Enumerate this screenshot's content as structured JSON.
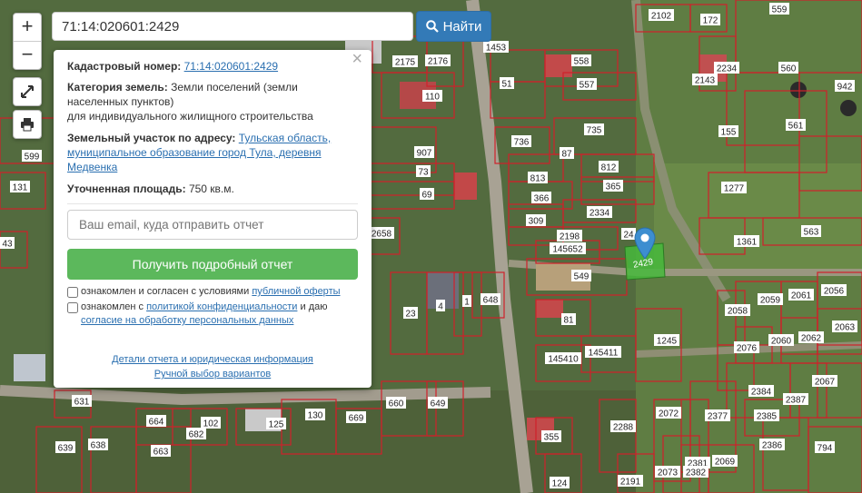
{
  "search": {
    "value": "71:14:020601:2429",
    "button_label": "Найти"
  },
  "zoom": {
    "in": "+",
    "out": "−"
  },
  "popup": {
    "cadastral_label": "Кадастровый номер:",
    "cadastral_value": "71:14:020601:2429",
    "category_label": "Категория земель:",
    "category_value": "Земли поселений (земли населенных пунктов)",
    "usage": "для индивидуального жилищного строительства",
    "address_label": "Земельный участок по адресу:",
    "address_value": "Тульская область, муниципальное образование город Тула, деревня Медвенка",
    "area_label": "Уточненная площадь:",
    "area_value": "750 кв.м.",
    "email_placeholder": "Ваш email, куда отправить отчет",
    "report_button": "Получить подробный отчет",
    "agree1_text": "ознакомлен и согласен с условиями",
    "agree1_link": "публичной оферты",
    "agree2_text": "ознакомлен с",
    "agree2_link1": "политикой конфиденциальности",
    "agree2_mid": "и даю",
    "agree2_link2": "согласие на обработку персональных данных",
    "details_link": "Детали отчета и юридическая информация",
    "manual_link": "Ручной выбор вариантов"
  },
  "marker_label": "2429",
  "parcel_labels": [
    "2102",
    "172",
    "559",
    "1453",
    "2175",
    "2176",
    "558",
    "560",
    "2234",
    "2143",
    "557",
    "110",
    "51",
    "942",
    "561",
    "155",
    "907",
    "736",
    "735",
    "599",
    "73",
    "87",
    "812",
    "131",
    "69",
    "813",
    "365",
    "1277",
    "366",
    "2334",
    "1361",
    "563",
    "309",
    "2198",
    "2658",
    "24",
    "145652",
    "549",
    "43",
    "2059",
    "2061",
    "2056",
    "2058",
    "2060",
    "2062",
    "2063",
    "648",
    "23",
    "4",
    "1",
    "81",
    "2076",
    "1245",
    "145410",
    "145411",
    "631",
    "2384",
    "2387",
    "2067",
    "660",
    "649",
    "2072",
    "2381",
    "2377",
    "2385",
    "664",
    "102",
    "125",
    "130",
    "669",
    "682",
    "2288",
    "2288",
    "2386",
    "355",
    "794",
    "639",
    "638",
    "663",
    "2073",
    "2382",
    "2069",
    "124",
    "2191"
  ]
}
